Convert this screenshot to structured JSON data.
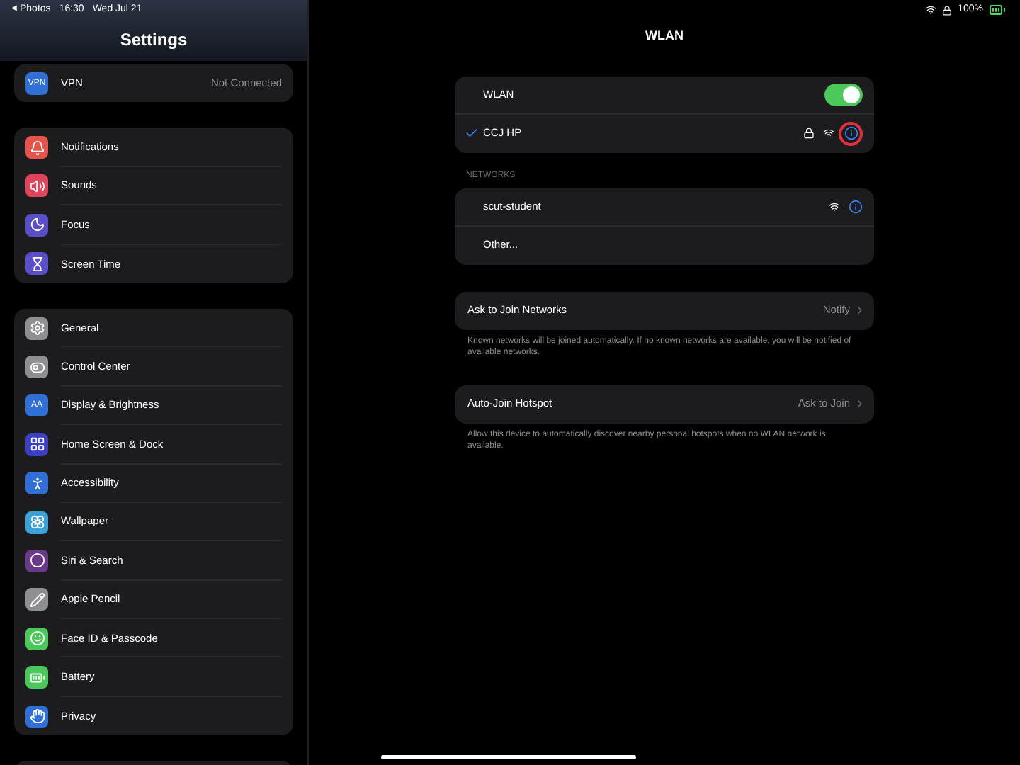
{
  "status_bar": {
    "back_arrow": "◀",
    "back_app": "Photos",
    "time": "16:30",
    "date": "Wed Jul 21",
    "battery": "100%"
  },
  "sidebar": {
    "title": "Settings",
    "groups": [
      [
        {
          "label": "VPN",
          "value": "Not Connected",
          "kind": "text",
          "icon_text": "VPN",
          "color": "#2f6fd6"
        }
      ],
      [
        {
          "label": "Notifications",
          "kind": "bell",
          "color": "#e5534b"
        },
        {
          "label": "Sounds",
          "kind": "sound",
          "color": "#e0435c"
        },
        {
          "label": "Focus",
          "kind": "moon",
          "color": "#5b4fc9"
        },
        {
          "label": "Screen Time",
          "kind": "hourglass",
          "color": "#5b4fc9"
        }
      ],
      [
        {
          "label": "General",
          "kind": "gear",
          "color": "#8e8e93"
        },
        {
          "label": "Control Center",
          "kind": "toggles",
          "color": "#8e8e93"
        },
        {
          "label": "Display & Brightness",
          "kind": "text",
          "icon_text": "AA",
          "color": "#2f6fd6"
        },
        {
          "label": "Home Screen & Dock",
          "kind": "grid",
          "color": "#3b3fc4"
        },
        {
          "label": "Accessibility",
          "kind": "person",
          "color": "#2f6fd6"
        },
        {
          "label": "Wallpaper",
          "kind": "flower",
          "color": "#3aa0d8"
        },
        {
          "label": "Siri & Search",
          "kind": "siri",
          "color": "#6a3a8a"
        },
        {
          "label": "Apple Pencil",
          "kind": "pencil",
          "color": "#8e8e93"
        },
        {
          "label": "Face ID & Passcode",
          "kind": "face",
          "color": "#4cc85a"
        },
        {
          "label": "Battery",
          "kind": "battery",
          "color": "#4cc85a"
        },
        {
          "label": "Privacy",
          "kind": "hand",
          "color": "#2f6fd6"
        }
      ]
    ]
  },
  "detail": {
    "title": "WLAN",
    "wlan": {
      "label": "WLAN",
      "on": true
    },
    "connected": {
      "name": "CCJ HP",
      "selected": true,
      "locked": true,
      "highlighted": true
    },
    "networks_header": "NETWORKS",
    "networks": [
      {
        "name": "scut-student",
        "locked": false
      }
    ],
    "other": "Other...",
    "settings": [
      {
        "label": "Ask to Join Networks",
        "value": "Notify",
        "footer": "Known networks will be joined automatically. If no known networks are available, you will be notified of available networks."
      },
      {
        "label": "Auto-Join Hotspot",
        "value": "Ask to Join",
        "footer": "Allow this device to automatically discover nearby personal hotspots when no WLAN network is available."
      }
    ]
  }
}
